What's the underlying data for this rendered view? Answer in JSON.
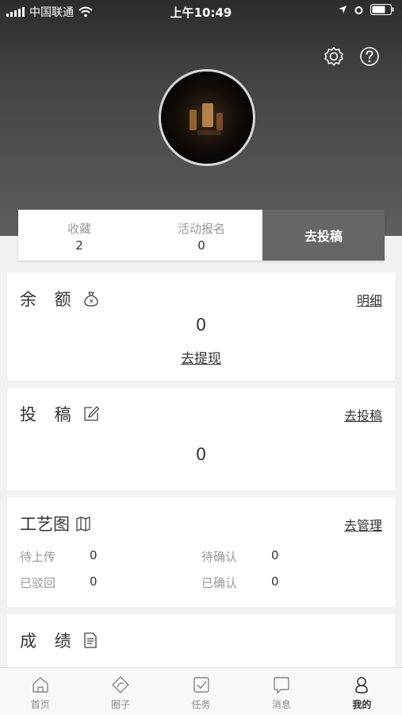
{
  "status_bar": {
    "carrier": "中国联通",
    "time": "上午10:49"
  },
  "stats": [
    {
      "label": "收藏",
      "value": "2"
    },
    {
      "label": "活动报名",
      "value": "0"
    }
  ],
  "submit_button": "去投稿",
  "balance": {
    "title": "余 额",
    "detail_link": "明细",
    "amount": "0",
    "withdraw_link": "去提现"
  },
  "submission": {
    "title": "投 稿",
    "link": "去投稿",
    "count": "0"
  },
  "craft": {
    "title": "工艺图",
    "link": "去管理",
    "items": [
      {
        "label": "待上传",
        "value": "0"
      },
      {
        "label": "待确认",
        "value": "0"
      },
      {
        "label": "已驳回",
        "value": "0"
      },
      {
        "label": "已确认",
        "value": "0"
      }
    ]
  },
  "score": {
    "title": "成 绩"
  },
  "tabs": [
    {
      "label": "首页",
      "icon": "home-icon"
    },
    {
      "label": "圈子",
      "icon": "circle-icon"
    },
    {
      "label": "任务",
      "icon": "task-icon"
    },
    {
      "label": "消息",
      "icon": "message-icon"
    },
    {
      "label": "我的",
      "icon": "profile-icon",
      "active": true
    }
  ],
  "colors": {
    "accent": "#666666",
    "header_dark": "#2c2c2c",
    "background": "#f1f1f1"
  }
}
